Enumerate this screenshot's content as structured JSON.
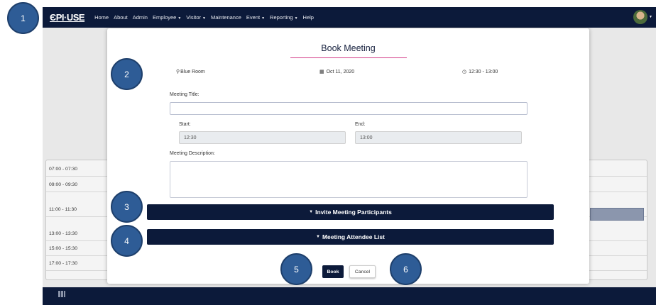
{
  "navbar": {
    "logo": "ЄPI·USE",
    "items": [
      {
        "label": "Home"
      },
      {
        "label": "About"
      },
      {
        "label": "Admin"
      },
      {
        "label": "Employee",
        "dropdown": true
      },
      {
        "label": "Visitor",
        "dropdown": true
      },
      {
        "label": "Maintenance"
      },
      {
        "label": "Event",
        "dropdown": true
      },
      {
        "label": "Reporting",
        "dropdown": true
      },
      {
        "label": "Help"
      }
    ],
    "avatar_icon": "user-avatar-icon"
  },
  "schedule": {
    "slots": [
      "07:00 - 07:30",
      "09:00 - 09:30",
      "11:00 - 11:30",
      "13:00 - 13:30",
      "15:00 - 15:30",
      "17:00 - 17:30"
    ]
  },
  "modal": {
    "title": "Book Meeting",
    "room": "Blue Room",
    "date": "Oct 11, 2020",
    "time": "12:30 - 13:00",
    "meeting_title_label": "Meeting Title:",
    "meeting_title_value": "",
    "start_label": "Start:",
    "start_value": "12:30",
    "end_label": "End:",
    "end_value": "13:00",
    "description_label": "Meeting Description:",
    "description_value": "",
    "invite_label": "Invite Meeting Participants",
    "attendee_label": "Meeting Attendee List",
    "book_label": "Book",
    "cancel_label": "Cancel",
    "colors": {
      "navy": "#0c1a3a",
      "accent": "#d23a87"
    }
  },
  "callouts": [
    "1",
    "2",
    "3",
    "4",
    "5",
    "6"
  ]
}
